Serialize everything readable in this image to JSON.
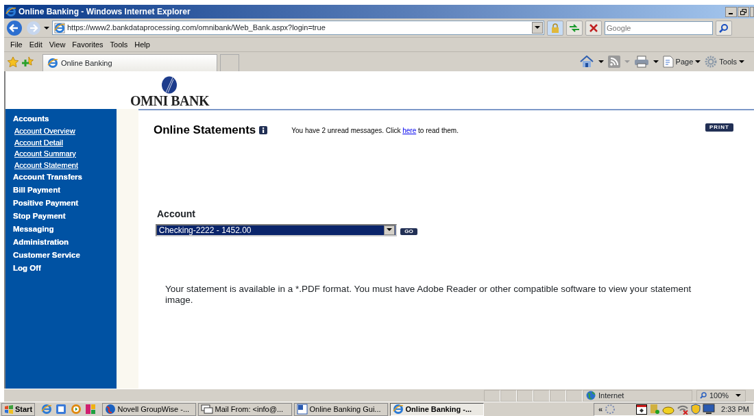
{
  "window": {
    "title": "Online Banking - Windows Internet Explorer"
  },
  "browser": {
    "address": "https://www2.bankdataprocessing.com/omnibank/Web_Bank.aspx?login=true",
    "search": {
      "placeholder": "Google"
    },
    "menu": [
      "File",
      "Edit",
      "View",
      "Favorites",
      "Tools",
      "Help"
    ],
    "tab": {
      "label": "Online Banking"
    },
    "commands": [
      "Page",
      "Tools"
    ]
  },
  "bank": {
    "name": "OMNI BANK"
  },
  "sidebar": {
    "items": [
      {
        "label": "Accounts",
        "kind": "section"
      },
      {
        "label": "Account Overview",
        "kind": "link"
      },
      {
        "label": "Account Detail",
        "kind": "link"
      },
      {
        "label": "Account Summary",
        "kind": "link"
      },
      {
        "label": "Account Statement",
        "kind": "link"
      },
      {
        "label": "Account Transfers",
        "kind": "section"
      },
      {
        "label": "Bill Payment",
        "kind": "section"
      },
      {
        "label": "Positive Payment",
        "kind": "section"
      },
      {
        "label": "Stop Payment",
        "kind": "section"
      },
      {
        "label": "Messaging",
        "kind": "section"
      },
      {
        "label": "Administration",
        "kind": "section"
      },
      {
        "label": "Customer Service",
        "kind": "section"
      },
      {
        "label": "Log Off",
        "kind": "section"
      }
    ]
  },
  "main": {
    "title": "Online Statements",
    "message": {
      "before": "You have 2 unread messages. Click",
      "link": "here",
      "after": "to read them."
    },
    "print_button": "PRINT",
    "account": {
      "label": "Account",
      "value": "Checking-2222 - 1452.00",
      "go_button": "GO"
    },
    "notice": "Your statement is available in a *.PDF format. You must have Adobe Reader or other compatible software to view your statement image."
  },
  "status_bar": {
    "zone": "Internet",
    "zoom": "100%"
  },
  "taskbar": {
    "start": "Start",
    "tasks": [
      {
        "label": "Novell GroupWise -...",
        "selected": false
      },
      {
        "label": "Mail From: <info@...",
        "selected": false
      },
      {
        "label": "Online Banking Gui...",
        "selected": false
      },
      {
        "label": "Online Banking -...",
        "selected": true
      }
    ],
    "tray_toggle": "«",
    "clock": "2:33 PM"
  }
}
